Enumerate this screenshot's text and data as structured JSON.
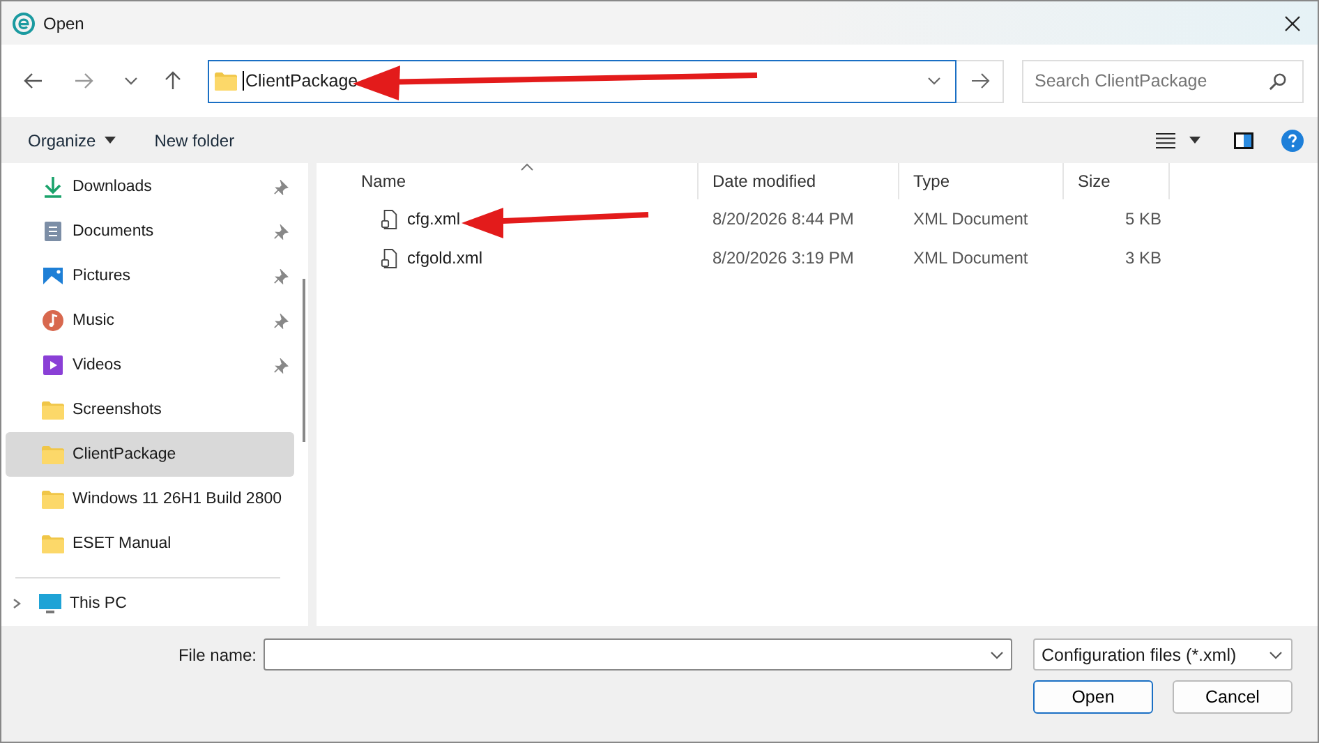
{
  "window": {
    "title": "Open"
  },
  "address_bar": {
    "value": "ClientPackage",
    "arrow": true
  },
  "search": {
    "placeholder": "Search ClientPackage"
  },
  "toolbar": {
    "organize": "Organize",
    "new_folder": "New folder"
  },
  "sidebar": {
    "items": [
      {
        "label": "Downloads",
        "kind": "downloads",
        "pinned": true,
        "selected": false
      },
      {
        "label": "Documents",
        "kind": "documents",
        "pinned": true,
        "selected": false
      },
      {
        "label": "Pictures",
        "kind": "pictures",
        "pinned": true,
        "selected": false
      },
      {
        "label": "Music",
        "kind": "music",
        "pinned": true,
        "selected": false
      },
      {
        "label": "Videos",
        "kind": "videos",
        "pinned": true,
        "selected": false
      },
      {
        "label": "Screenshots",
        "kind": "folder",
        "pinned": false,
        "selected": false
      },
      {
        "label": "ClientPackage",
        "kind": "folder",
        "pinned": false,
        "selected": true
      },
      {
        "label": "Windows 11 26H1 Build 2800",
        "kind": "folder",
        "pinned": false,
        "selected": false
      },
      {
        "label": "ESET Manual",
        "kind": "folder",
        "pinned": false,
        "selected": false
      }
    ],
    "bottom_item": {
      "label": "This PC",
      "expanded": false
    }
  },
  "table": {
    "columns": [
      "Name",
      "Date modified",
      "Type",
      "Size"
    ],
    "rows": [
      {
        "name": "cfg.xml",
        "date": "8/20/2026 8:44 PM",
        "type": "XML Document",
        "size": "5 KB",
        "arrow": true
      },
      {
        "name": "cfgold.xml",
        "date": "8/20/2026 3:19 PM",
        "type": "XML Document",
        "size": "3 KB",
        "arrow": false
      }
    ]
  },
  "footer": {
    "file_name_label": "File name:",
    "filter": "Configuration files (*.xml)",
    "buttons": [
      {
        "label": "Open",
        "kind": "primary"
      },
      {
        "label": "Cancel",
        "kind": "secondary"
      }
    ]
  }
}
